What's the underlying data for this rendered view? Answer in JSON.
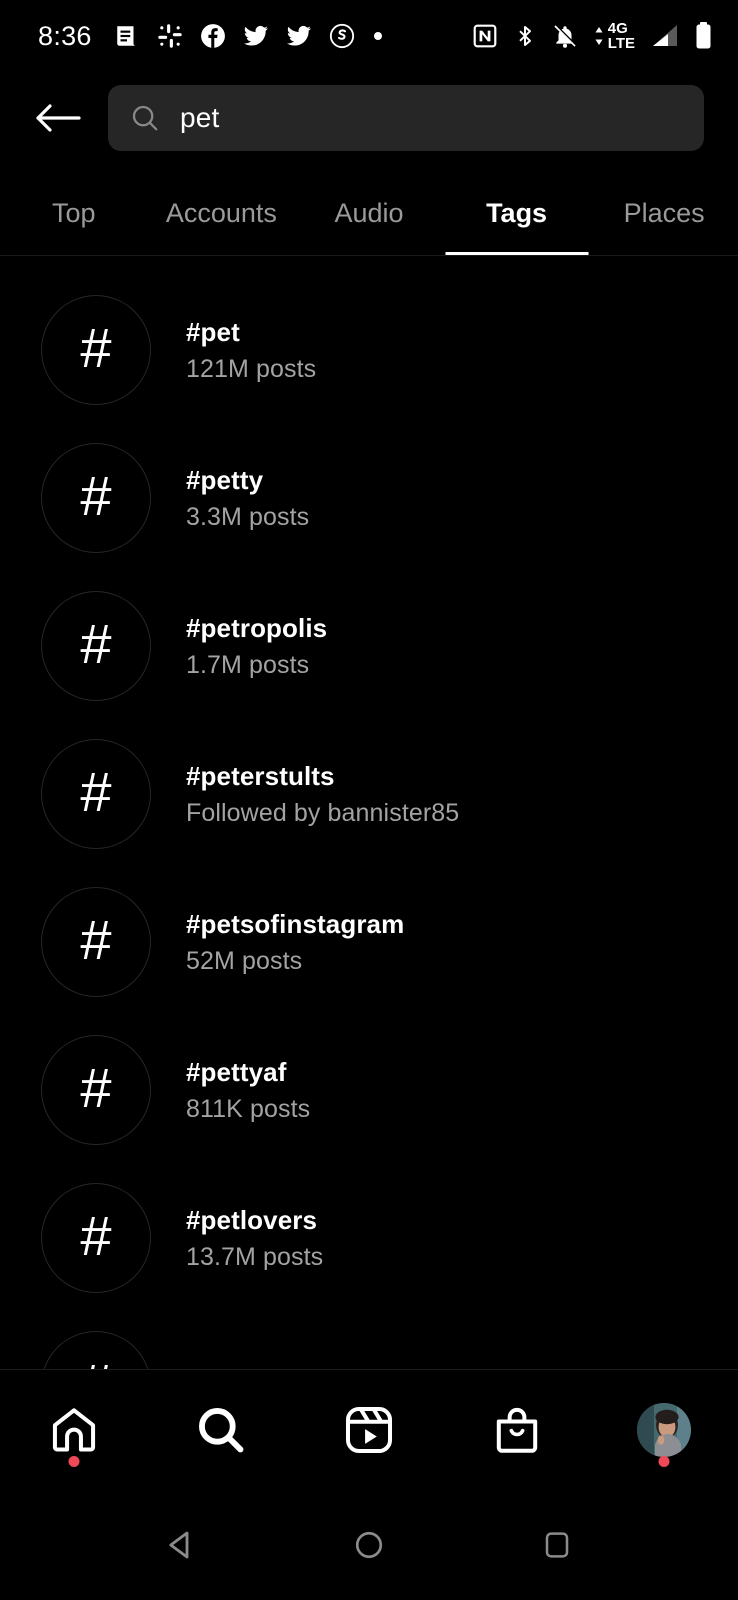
{
  "status_bar": {
    "time": "8:36",
    "notification_icons": [
      "news-icon",
      "slack-icon",
      "facebook-icon",
      "twitter-icon",
      "twitter-icon",
      "signal-icon",
      "dot-icon"
    ],
    "system_icons": [
      "nfc-icon",
      "bluetooth-icon",
      "notifications-muted-icon",
      "mobile-data-icon",
      "signal-bars-icon",
      "battery-icon"
    ],
    "network_line1": "4G",
    "network_line2": "LTE"
  },
  "header": {
    "back_label": "Back",
    "search_value": "pet",
    "search_placeholder": "Search"
  },
  "tabs": [
    {
      "label": "Top",
      "active": false
    },
    {
      "label": "Accounts",
      "active": false
    },
    {
      "label": "Audio",
      "active": false
    },
    {
      "label": "Tags",
      "active": true
    },
    {
      "label": "Places",
      "active": false
    }
  ],
  "results": [
    {
      "hash": "#",
      "title": "#pet",
      "subtitle": "121M posts"
    },
    {
      "hash": "#",
      "title": "#petty",
      "subtitle": "3.3M posts"
    },
    {
      "hash": "#",
      "title": "#petropolis",
      "subtitle": "1.7M posts"
    },
    {
      "hash": "#",
      "title": "#peterstults",
      "subtitle": "Followed by bannister85"
    },
    {
      "hash": "#",
      "title": "#petsofinstagram",
      "subtitle": "52M posts"
    },
    {
      "hash": "#",
      "title": "#pettyaf",
      "subtitle": "811K posts"
    },
    {
      "hash": "#",
      "title": "#petlovers",
      "subtitle": "13.7M posts"
    },
    {
      "hash": "#",
      "title": "",
      "subtitle": ""
    }
  ],
  "bottom_nav": [
    {
      "name": "home",
      "icon": "home-icon",
      "active": false,
      "badge": true
    },
    {
      "name": "search",
      "icon": "search-icon",
      "active": true,
      "badge": false
    },
    {
      "name": "reels",
      "icon": "reels-icon",
      "active": false,
      "badge": false
    },
    {
      "name": "shop",
      "icon": "shop-bag-icon",
      "active": false,
      "badge": false
    },
    {
      "name": "profile",
      "icon": "avatar-icon",
      "active": false,
      "badge": true
    }
  ],
  "android_nav": [
    "back-triangle-icon",
    "home-circle-icon",
    "recents-square-icon"
  ],
  "colors": {
    "background": "#000000",
    "search_field": "#262626",
    "subtitle_text": "#a3a3a3",
    "inactive_tab": "#9a9a9a",
    "badge_red": "#ed4956",
    "divider": "#1c1c1c"
  }
}
